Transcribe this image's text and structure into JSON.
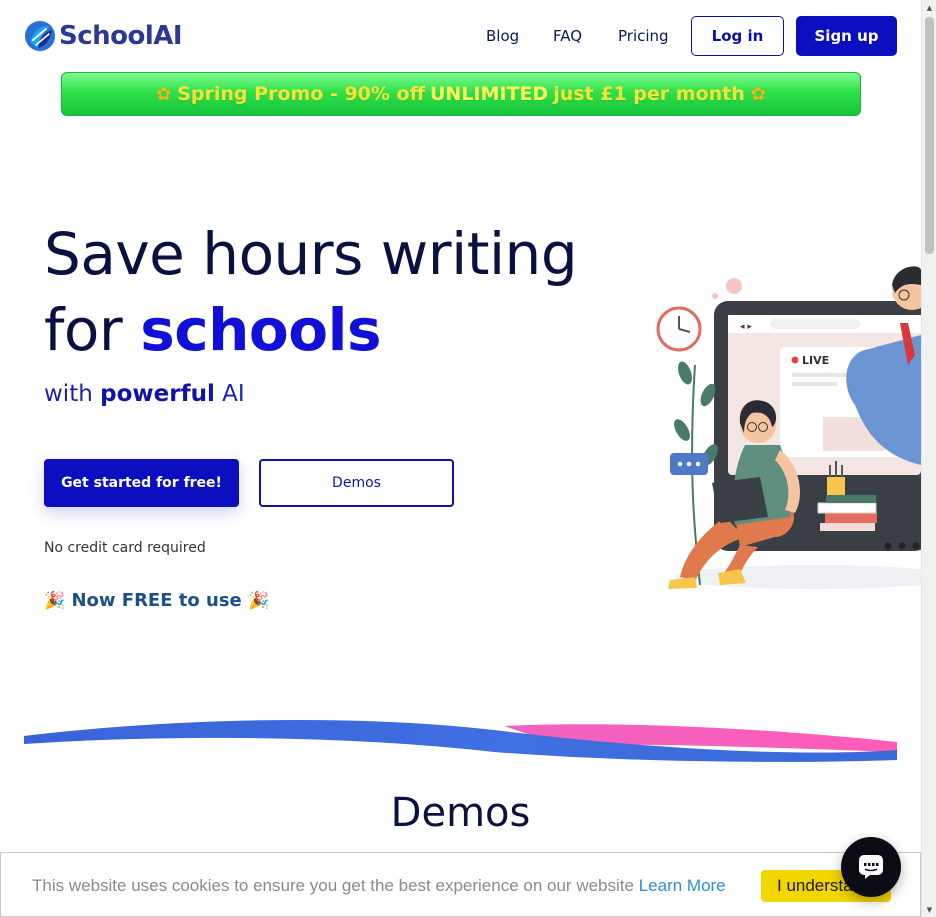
{
  "brand": {
    "name": "SchoolAI"
  },
  "nav": {
    "links": [
      "Blog",
      "FAQ",
      "Pricing"
    ],
    "login": "Log in",
    "signup": "Sign up"
  },
  "promo": {
    "lead": "Spring Promo - 90% off",
    "highlight": "UNLIMITED",
    "tail": "just £1 per month",
    "icon": "flower-emoji"
  },
  "hero": {
    "title_line1": "Save hours writing",
    "title_line2_prefix": "for",
    "title_line2_accent": "schools",
    "subtitle_prefix": "with",
    "subtitle_bold": "powerful",
    "subtitle_suffix": "AI",
    "cta_primary": "Get started for free!",
    "cta_secondary": "Demos",
    "note": "No credit card required",
    "free_text": "Now FREE to use",
    "free_icon": "party-popper-emoji"
  },
  "illustration": {
    "live_label": "LIVE"
  },
  "sections": {
    "demos_heading": "Demos"
  },
  "cookie": {
    "message": "This website uses cookies to ensure you get the best experience on our website",
    "learn_more": "Learn More",
    "accept": "I understand"
  },
  "colors": {
    "primary": "#0b0fc0",
    "navy": "#091142",
    "promo_green": "#2fe04a",
    "cookie_yellow": "#f1d600",
    "link_blue": "#2f8fd6"
  }
}
